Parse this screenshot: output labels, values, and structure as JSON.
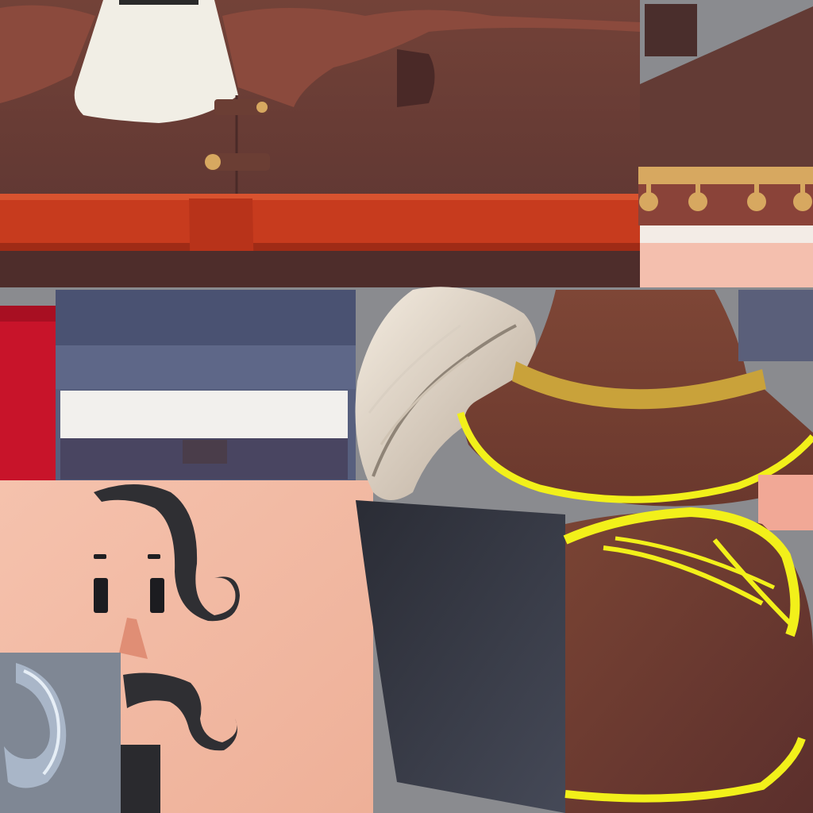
{
  "image_kind": "character texture atlas (UV map)",
  "colors": {
    "background_gray": "#8a8b8f",
    "coat_brown": "#6b3f38",
    "coat_brown_dark": "#4f2d2b",
    "lapel_brown": "#8a4a3e",
    "belt_red": "#c63a1d",
    "belt_red_dark": "#a02a14",
    "collar_white": "#f2efe6",
    "skin": "#f1b7a0",
    "skin_light": "#f6cab6",
    "hair_black": "#2f2f33",
    "boot_black": "#2b2d35",
    "navy": "#565e80",
    "navy_dark": "#3f4666",
    "trim_white": "#f3f1ee",
    "hat_brown": "#7a4233",
    "hat_band_gold": "#c9a23a",
    "neon_yellow": "#f2f01a",
    "feather_cream": "#e8dccb",
    "red_cloth": "#c8142a",
    "steel_gray": "#7d8592",
    "button_gold": "#d7a860"
  },
  "regions": [
    {
      "name": "coat-front",
      "desc_icon": "coat-icon"
    },
    {
      "name": "belt",
      "desc_icon": "belt-icon"
    },
    {
      "name": "cuff-trim",
      "desc_icon": "trim-icon"
    },
    {
      "name": "navy-band",
      "desc_icon": "band-icon"
    },
    {
      "name": "red-cloth",
      "desc_icon": "cloth-icon"
    },
    {
      "name": "face",
      "desc_icon": "face-icon"
    },
    {
      "name": "feather",
      "desc_icon": "feather-icon"
    },
    {
      "name": "hat",
      "desc_icon": "hat-icon"
    },
    {
      "name": "boot",
      "desc_icon": "boot-icon"
    },
    {
      "name": "shoulder-rope",
      "desc_icon": "rope-icon"
    },
    {
      "name": "steel-hook",
      "desc_icon": "hook-icon"
    }
  ]
}
